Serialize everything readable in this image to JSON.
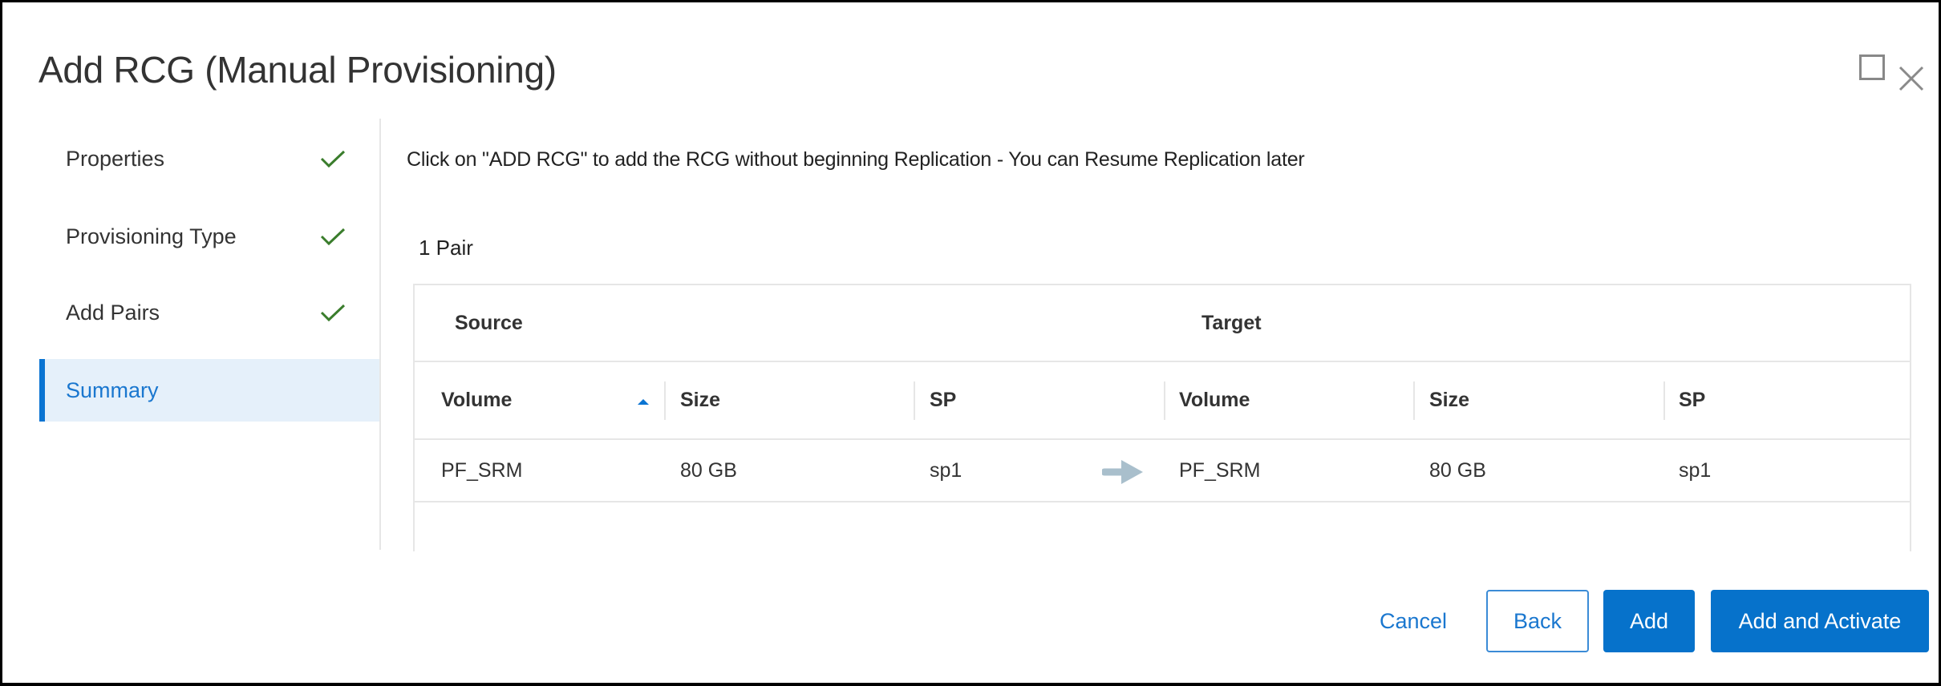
{
  "dialog": {
    "title": "Add RCG (Manual Provisioning)",
    "window_controls": [
      "maximize-icon",
      "close-icon"
    ]
  },
  "sidebar": {
    "steps": [
      {
        "label": "Properties",
        "status": "complete",
        "icon": "check-icon"
      },
      {
        "label": "Provisioning Type",
        "status": "complete",
        "icon": "check-icon"
      },
      {
        "label": "Add Pairs",
        "status": "complete",
        "icon": "check-icon"
      },
      {
        "label": "Summary",
        "status": "active"
      }
    ]
  },
  "content": {
    "instruction": "Click on \"ADD RCG\" to add the RCG without beginning Replication - You can Resume Replication later",
    "pair_count": "1 Pair",
    "table": {
      "groups": [
        "Source",
        "Target"
      ],
      "columns": [
        "Volume",
        "Size",
        "SP",
        "Volume",
        "Size",
        "SP"
      ],
      "sort": {
        "column": "Volume",
        "direction": "ascending"
      },
      "rows": [
        {
          "source_volume": "PF_SRM",
          "source_size": "80 GB",
          "source_sp": "sp1",
          "target_volume": "PF_SRM",
          "target_size": "80 GB",
          "target_sp": "sp1",
          "mapping_icon": "arrow-right-icon"
        }
      ]
    }
  },
  "footer": {
    "cancel_label": "Cancel",
    "back_label": "Back",
    "add_label": "Add",
    "add_activate_label": "Add and Activate"
  },
  "colors": {
    "accent": "#0672cb",
    "link": "#1a77cf",
    "check": "#3a7d2c",
    "active_step_bg": "#e5f0fa",
    "arrow": "#a9bfcc"
  }
}
